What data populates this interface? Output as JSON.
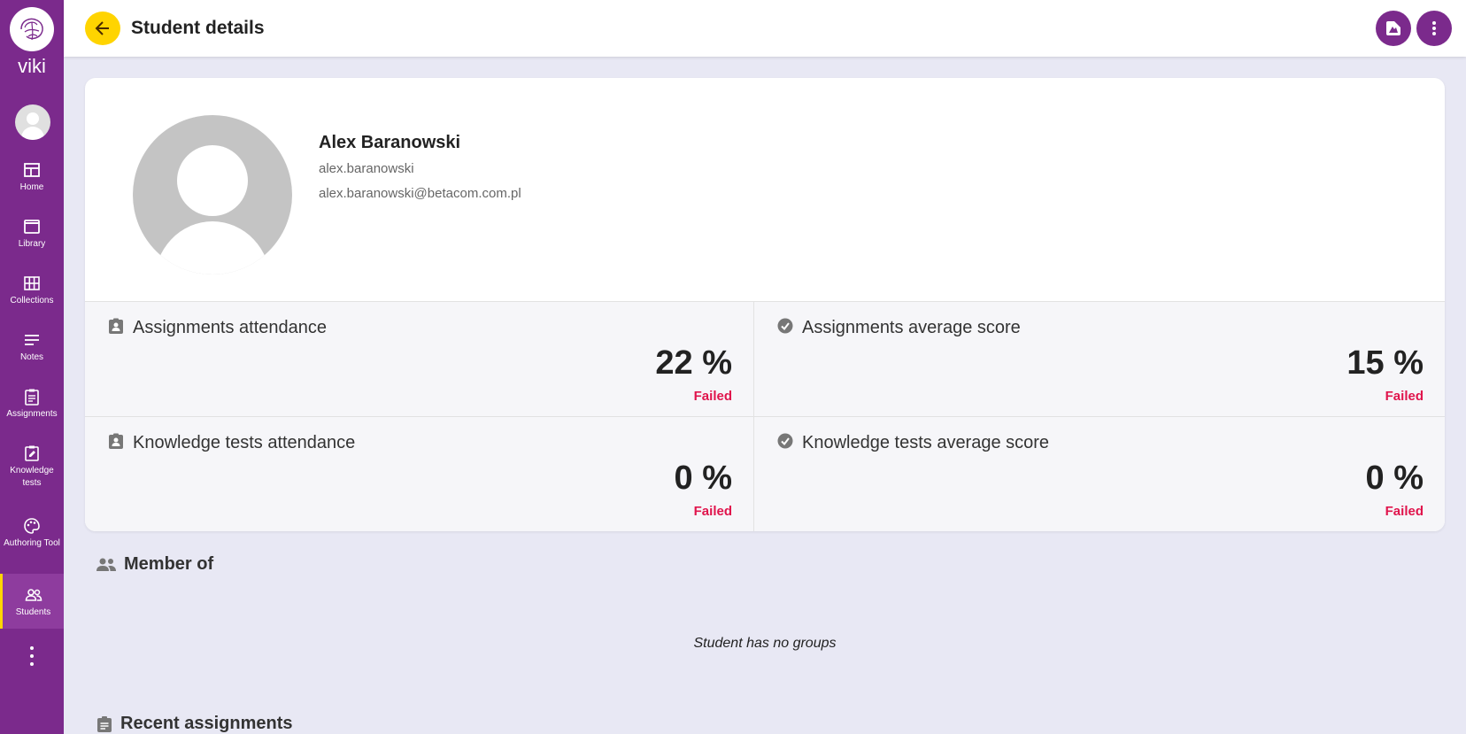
{
  "app": {
    "logo_text": "viki"
  },
  "sidebar": {
    "items": [
      {
        "label": "Home",
        "icon": "home-dashboard-icon"
      },
      {
        "label": "Library",
        "icon": "library-icon"
      },
      {
        "label": "Collections",
        "icon": "collections-grid-icon"
      },
      {
        "label": "Notes",
        "icon": "notes-lines-icon"
      },
      {
        "label": "Assignments",
        "icon": "clipboard-icon"
      },
      {
        "label": "Knowledge tests",
        "icon": "edit-square-icon"
      },
      {
        "label": "Authoring Tool",
        "icon": "palette-icon"
      },
      {
        "label": "Students",
        "icon": "people-icon",
        "active": true
      }
    ]
  },
  "header": {
    "title": "Student details"
  },
  "profile": {
    "name": "Alex Baranowski",
    "username": "alex.baranowski",
    "email": "alex.baranowski@betacom.com.pl"
  },
  "stats": {
    "assignments_attendance": {
      "title": "Assignments attendance",
      "value": "22 %",
      "status": "Failed"
    },
    "assignments_average": {
      "title": "Assignments average score",
      "value": "15 %",
      "status": "Failed"
    },
    "tests_attendance": {
      "title": "Knowledge tests attendance",
      "value": "0 %",
      "status": "Failed"
    },
    "tests_average": {
      "title": "Knowledge tests average score",
      "value": "0 %",
      "status": "Failed"
    }
  },
  "member_of": {
    "title": "Member of",
    "empty_message": "Student has no groups"
  },
  "recent_assignments": {
    "title": "Recent assignments"
  },
  "colors": {
    "sidebar": "#7b2a8c",
    "accent": "#ffd400",
    "failed": "#e0144c",
    "background": "#e8e8f4"
  }
}
